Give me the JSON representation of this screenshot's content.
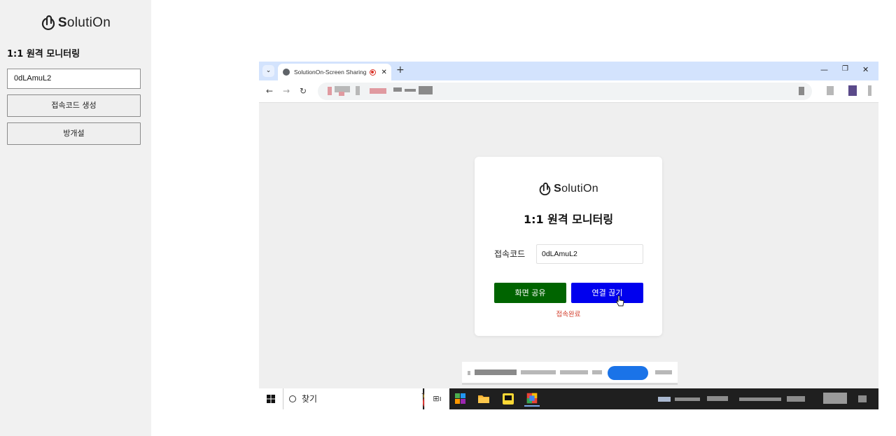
{
  "sidebar": {
    "logo": {
      "prefix": "S",
      "rest": "olutiOn"
    },
    "title": "1:1 원격 모니터링",
    "code_value": "0dLAmuL2",
    "generate_label": "접속코드 생성",
    "room_label": "방개설"
  },
  "browser": {
    "tab_title": "SolutionOn-Screen Sharing",
    "tab_close": "✕",
    "new_tab": "+",
    "tab_menu": "⌄",
    "window_controls": {
      "minimize": "—",
      "restore": "❐",
      "close": "✕"
    },
    "nav": {
      "back": "←",
      "forward": "→",
      "reload": "↻"
    }
  },
  "card": {
    "logo": {
      "prefix": "S",
      "rest": "olutiOn"
    },
    "title": "1:1 원격 모니터링",
    "code_label": "접속코드",
    "code_value": "0dLAmuL2",
    "share_label": "화면 공유",
    "disconnect_label": "연결 끊기",
    "status": "접속완료",
    "colors": {
      "share": "#006400",
      "disconnect": "#0000ee",
      "status": "#d23c2a"
    }
  },
  "taskbar": {
    "search_label": "찾기",
    "task_view": "⊞ı"
  }
}
